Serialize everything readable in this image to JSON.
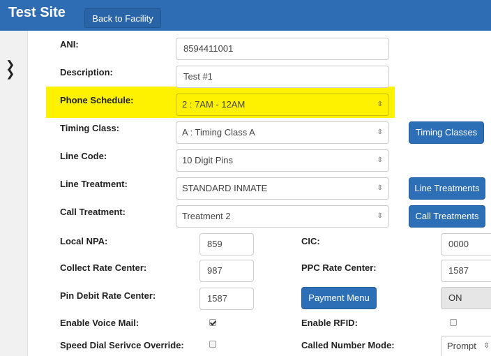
{
  "header": {
    "site_title": "Test Site",
    "back_button": "Back to Facility"
  },
  "sidebar": {
    "icons": [
      "chevron-right-icon",
      "chevron-right-icon"
    ]
  },
  "form": {
    "ani": {
      "label": "ANI:",
      "value": "8594411001"
    },
    "description": {
      "label": "Description:",
      "value": "Test #1"
    },
    "phone_schedule": {
      "label": "Phone Schedule:",
      "value": "2 : 7AM - 12AM"
    },
    "timing_class": {
      "label": "Timing Class:",
      "value": "A : Timing Class A",
      "button": "Timing Classes"
    },
    "line_code": {
      "label": "Line Code:",
      "value": "10 Digit Pins"
    },
    "line_treatment": {
      "label": "Line Treatment:",
      "value": "STANDARD INMATE",
      "button": "Line Treatments"
    },
    "call_treatment": {
      "label": "Call Treatment:",
      "value": "Treatment 2",
      "button": "Call Treatments"
    },
    "local_npa": {
      "label": "Local NPA:",
      "value": "859"
    },
    "cic": {
      "label": "CIC:",
      "value": "0000"
    },
    "collect_rate_center": {
      "label": "Collect Rate Center:",
      "value": "987"
    },
    "ppc_rate_center": {
      "label": "PPC Rate Center:",
      "value": "1587"
    },
    "pin_debit_rate_center": {
      "label": "Pin Debit Rate Center:",
      "value": "1587"
    },
    "payment_menu": {
      "button": "Payment Menu",
      "toggle_value": "ON"
    },
    "enable_voice_mail": {
      "label": "Enable Voice Mail:",
      "checked": true
    },
    "enable_rfid": {
      "label": "Enable RFID:",
      "checked": false
    },
    "speed_dial_override": {
      "label": "Speed Dial Serivce Override:",
      "checked": false
    },
    "called_number_mode": {
      "label": "Called Number Mode:",
      "value": "Prompt"
    }
  },
  "colors": {
    "header_blue": "#2e6db4",
    "button_blue": "#2d6fb7",
    "highlight_yellow": "#fff200"
  }
}
